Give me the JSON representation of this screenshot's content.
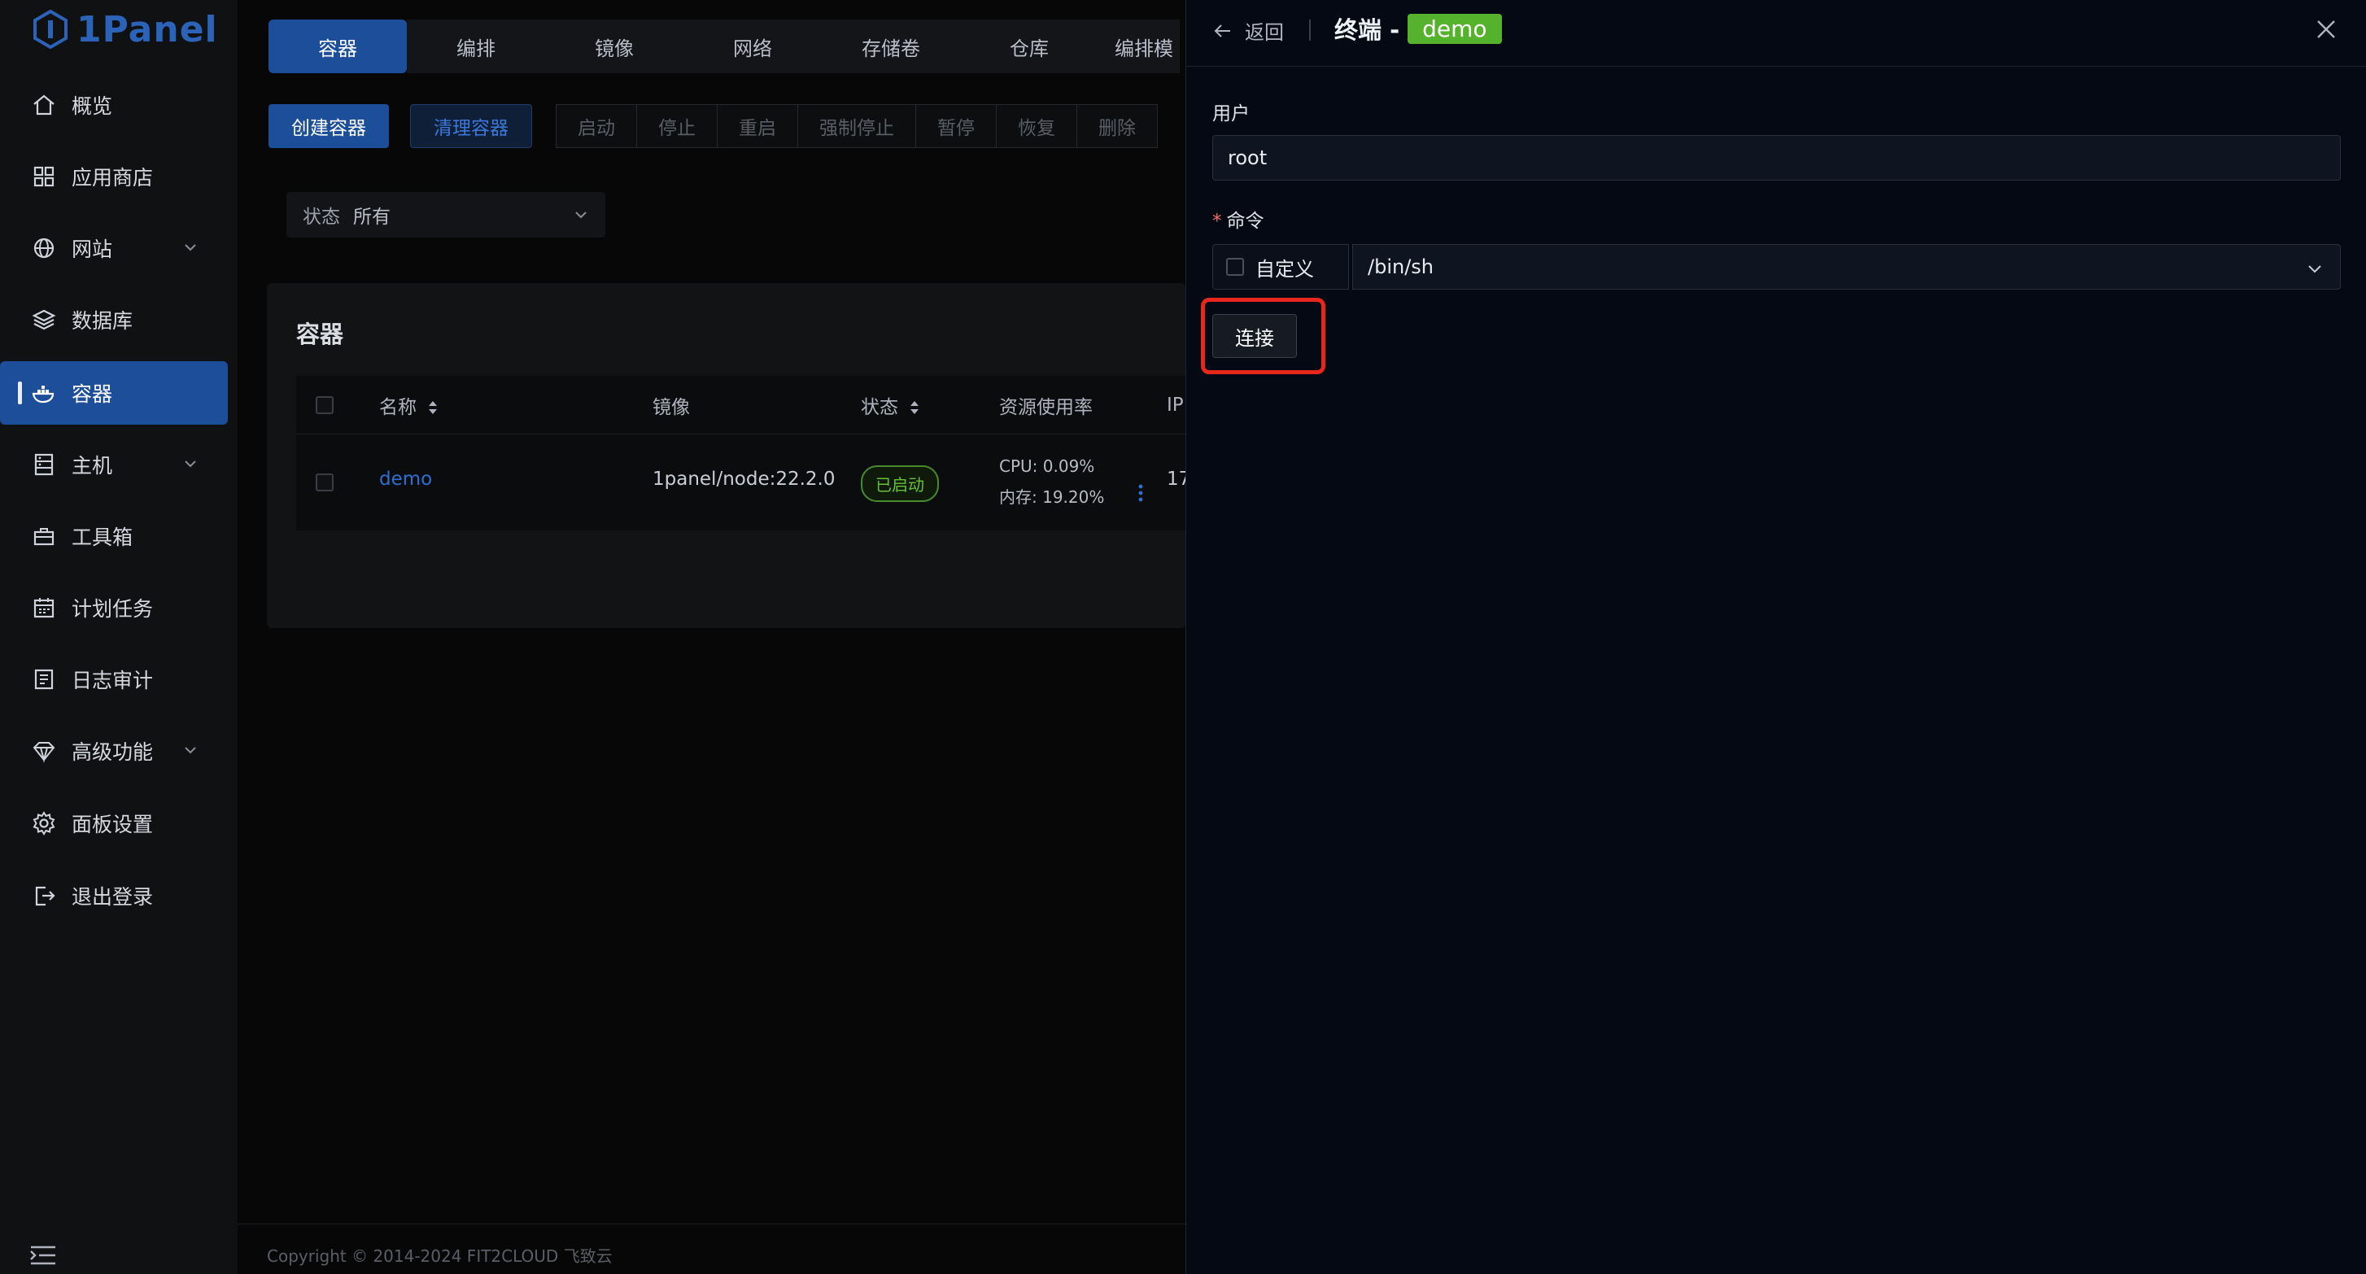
{
  "app": {
    "logo_text": "1Panel"
  },
  "sidebar": {
    "items": [
      {
        "label": "概览",
        "icon": "home-icon"
      },
      {
        "label": "应用商店",
        "icon": "apps-grid-icon"
      },
      {
        "label": "网站",
        "icon": "globe-icon",
        "expandable": true
      },
      {
        "label": "数据库",
        "icon": "database-layers-icon"
      },
      {
        "label": "容器",
        "icon": "docker-icon",
        "active": true
      },
      {
        "label": "主机",
        "icon": "server-icon",
        "expandable": true
      },
      {
        "label": "工具箱",
        "icon": "toolbox-icon"
      },
      {
        "label": "计划任务",
        "icon": "calendar-icon"
      },
      {
        "label": "日志审计",
        "icon": "log-icon"
      },
      {
        "label": "高级功能",
        "icon": "diamond-icon",
        "expandable": true
      },
      {
        "label": "面板设置",
        "icon": "gear-icon"
      },
      {
        "label": "退出登录",
        "icon": "logout-icon"
      }
    ]
  },
  "main": {
    "tabs": [
      "容器",
      "编排",
      "镜像",
      "网络",
      "存储卷",
      "仓库",
      "编排模"
    ],
    "active_tab": "容器",
    "toolbar": {
      "create": "创建容器",
      "clean": "清理容器",
      "group": [
        "启动",
        "停止",
        "重启",
        "强制停止",
        "暂停",
        "恢复",
        "删除"
      ]
    },
    "filter": {
      "label": "状态",
      "value": "所有"
    },
    "card_title": "容器",
    "table": {
      "headers": {
        "name": "名称",
        "image": "镜像",
        "state": "状态",
        "usage": "资源使用率",
        "ip": "IP"
      },
      "rows": [
        {
          "name": "demo",
          "image": "1panel/node:22.2.0",
          "state": "已启动",
          "cpu": "CPU: 0.09%",
          "mem": "内存: 19.20%",
          "ip": "17"
        }
      ]
    },
    "footer": "Copyright © 2014-2024 FIT2CLOUD 飞致云"
  },
  "drawer": {
    "back": "返回",
    "title": "终端 -",
    "tag": "demo",
    "user_label": "用户",
    "user_value": "root",
    "command_label": "命令",
    "custom_label": "自定义",
    "command_value": "/bin/sh",
    "connect": "连接"
  },
  "colors": {
    "primary": "#1d4e9a",
    "success": "#55b22c",
    "highlight": "#e8271c"
  }
}
